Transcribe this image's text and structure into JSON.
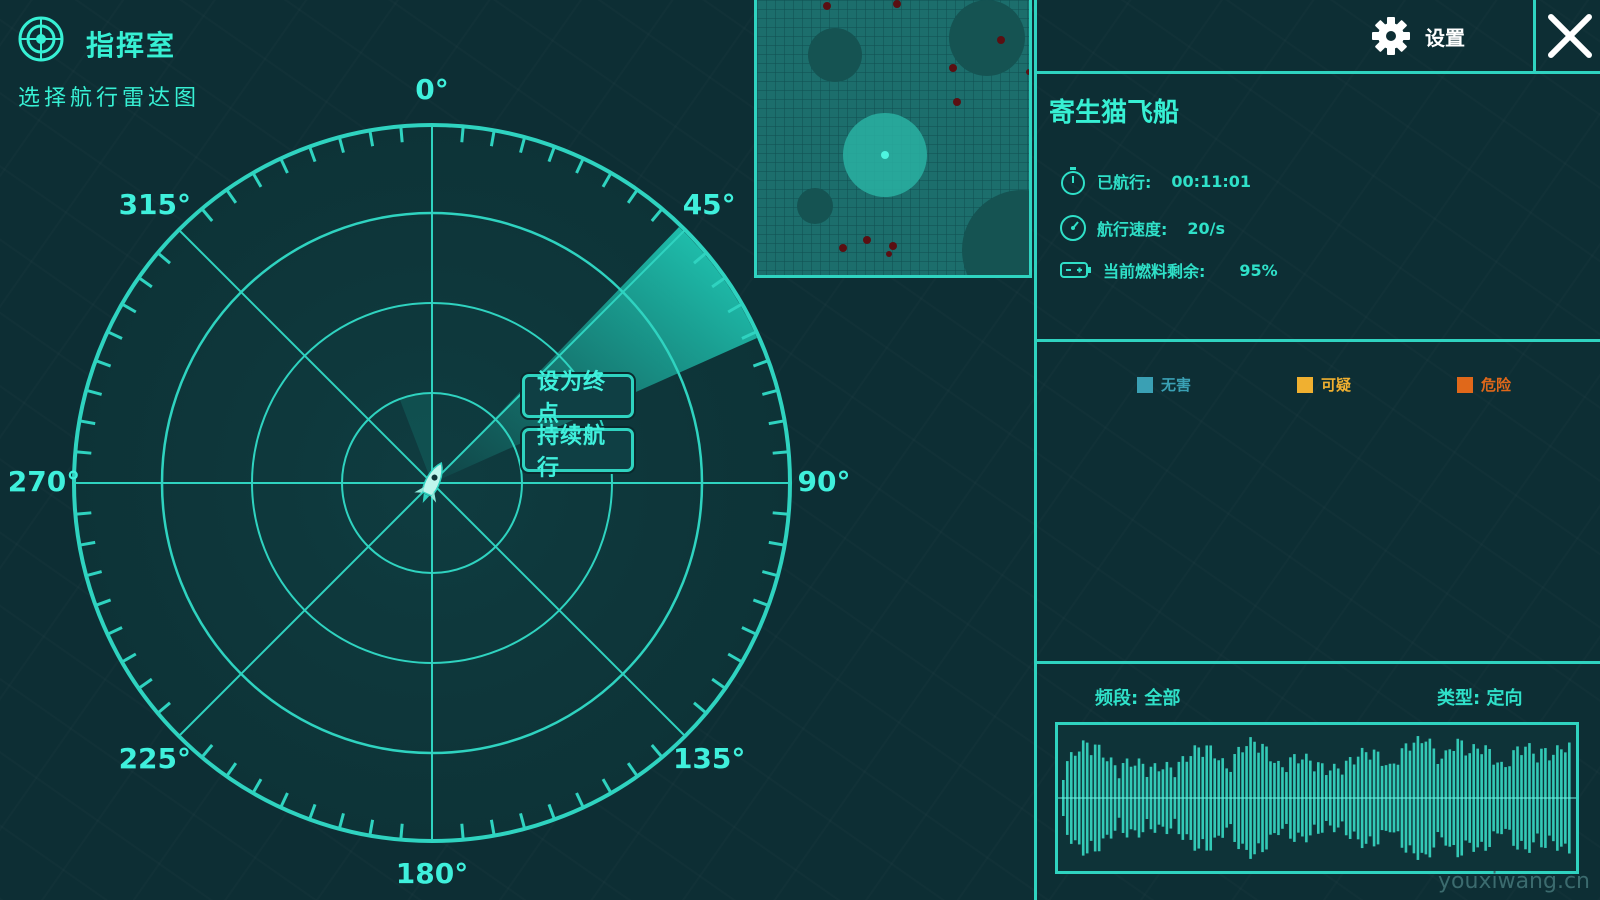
{
  "header": {
    "title": "指挥室",
    "subtitle": "选择航行雷达图"
  },
  "radar": {
    "degree_labels": [
      "0°",
      "45°",
      "90°",
      "135°",
      "180°",
      "225°",
      "270°",
      "315°"
    ],
    "sweep_direction_deg": 60,
    "context_menu": {
      "set_destination": "设为终点",
      "continue_sailing": "持续航行"
    }
  },
  "topbar": {
    "settings_label": "设置"
  },
  "ship": {
    "name": "寄生猫飞船",
    "stats": {
      "elapsed_label": "已航行:",
      "elapsed_value": "00:11:01",
      "speed_label": "航行速度:",
      "speed_value": "20/s",
      "fuel_label": "当前燃料剩余:",
      "fuel_value": "95%"
    }
  },
  "legend": {
    "items": [
      {
        "label": "无害",
        "color": "#3aa0b4"
      },
      {
        "label": "可疑",
        "color": "#f0b030"
      },
      {
        "label": "危险",
        "color": "#e0681a"
      }
    ]
  },
  "signal": {
    "band_label": "频段: 全部",
    "type_label": "类型: 定向"
  },
  "colors": {
    "accent": "#2fd3c0",
    "background": "#0d2e34"
  },
  "watermark": "youxiwang.cn"
}
